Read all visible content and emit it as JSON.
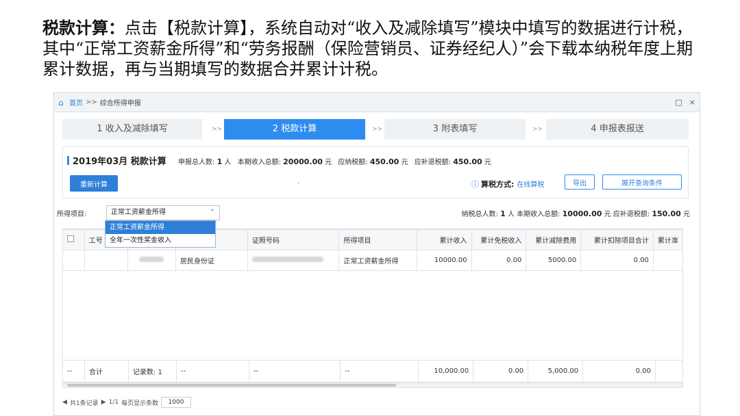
{
  "caption": {
    "lead": "税款计算：",
    "body": "点击【税款计算】，系统自动对“收入及减除填写”模块中填写的数据进行计税，其中“正常工资薪金所得”和“劳务报酬（保险营销员、证券经纪人）”会下载本纳税年度上期累计数据，再与当期填写的数据合并累计计税。"
  },
  "titlebar": {
    "home": "首页",
    "sep": ">>",
    "page": "综合所得申报",
    "restore": "□",
    "close": "×"
  },
  "steps": [
    {
      "label": "1 收入及减除填写"
    },
    {
      "label": "2 税款计算"
    },
    {
      "label": "3 附表填写"
    },
    {
      "label": "4 申报表报送"
    }
  ],
  "step_sep": ">>",
  "summary": {
    "period": "2019年03月 税款计算",
    "count_label": "申报总人数:",
    "count_value": "1",
    "count_unit": "人",
    "income_label": "本期收入总额:",
    "income_value": "20000.00",
    "income_unit": "元",
    "tax_label": "应纳税额:",
    "tax_value": "450.00",
    "tax_unit": "元",
    "refund_label": "应补退税额:",
    "refund_value": "450.00",
    "refund_unit": "元",
    "recalc": "重新计算",
    "dot": ".",
    "mode_label": "算税方式:",
    "mode_value": "在线算税",
    "export": "导出",
    "expand": "展开查询条件"
  },
  "filter": {
    "label": "所得项目:",
    "selected": "正常工资薪金所得",
    "options": [
      "正常工资薪金所得",
      "全年一次性奖金收入"
    ],
    "stats_count_label": "纳税总人数:",
    "stats_count": "1",
    "stats_count_unit": "人",
    "stats_income_label": "本期收入总额:",
    "stats_income": "10000.00",
    "stats_income_unit": "元",
    "stats_refund_label": "应补退税额:",
    "stats_refund": "150.00",
    "stats_refund_unit": "元"
  },
  "table": {
    "headers": [
      "",
      "工号",
      "",
      "",
      "证照号码",
      "所得项目",
      "累计收入",
      "累计免税收入",
      "累计减除费用",
      "累计扣除项目合计",
      "累计准"
    ],
    "row": {
      "id_type": "居民身份证",
      "income_item": "正常工资薪金所得",
      "cum_income": "10000.00",
      "cum_exempt": "0.00",
      "cum_deduct": "5000.00",
      "cum_items": "0.00"
    },
    "total": {
      "c1": "--",
      "c2": "合计",
      "c3": "记录数: 1",
      "c4": "--",
      "c5": "--",
      "c6": "--",
      "cum_income": "10,000.00",
      "cum_exempt": "0.00",
      "cum_deduct": "5,000.00",
      "cum_items": "0.00"
    }
  },
  "pager": {
    "prev": "◀",
    "records": "共1条记录",
    "next": "▶",
    "pages": "1/1",
    "per_page_label": "每页显示条数",
    "per_page": "1000"
  }
}
